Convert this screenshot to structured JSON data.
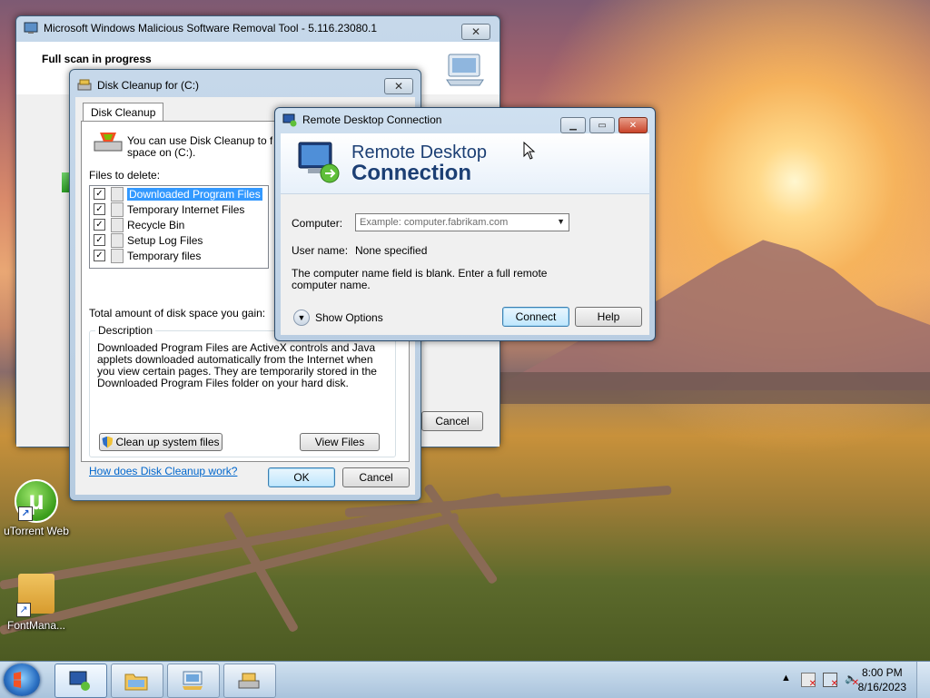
{
  "desktop": {
    "icons": [
      {
        "label": "uTorrent Web"
      },
      {
        "label": "FontMana..."
      }
    ]
  },
  "msrt": {
    "title": "Microsoft Windows Malicious Software Removal Tool - 5.116.23080.1",
    "heading": "Full scan in progress",
    "cancel_label": "Cancel"
  },
  "disk_cleanup": {
    "title": "Disk Cleanup for  (C:)",
    "tab_label": "Disk Cleanup",
    "intro": "You can use Disk Cleanup to free",
    "intro2": "space on  (C:).",
    "files_to_delete_label": "Files to delete:",
    "files": [
      {
        "name": "Downloaded Program Files",
        "checked": true,
        "selected": true
      },
      {
        "name": "Temporary Internet Files",
        "checked": true
      },
      {
        "name": "Recycle Bin",
        "checked": true
      },
      {
        "name": "Setup Log Files",
        "checked": true
      },
      {
        "name": "Temporary files",
        "checked": true
      }
    ],
    "total_label": "Total amount of disk space you gain:",
    "description_legend": "Description",
    "description_text": "Downloaded Program Files are ActiveX controls and Java applets downloaded automatically from the Internet when you view certain pages. They are temporarily stored in the Downloaded Program Files folder on your hard disk.",
    "cleanup_system_label": "Clean up system files",
    "view_files_label": "View Files",
    "help_link": "How does Disk Cleanup work?",
    "ok_label": "OK",
    "cancel_label": "Cancel"
  },
  "rdc": {
    "title": "Remote Desktop Connection",
    "banner_line1": "Remote Desktop",
    "banner_line2": "Connection",
    "computer_label": "Computer:",
    "computer_placeholder": "Example: computer.fabrikam.com",
    "username_label": "User name:",
    "username_value": "None specified",
    "message": "The computer name field is blank. Enter a full remote computer name.",
    "show_options_label": "Show Options",
    "connect_label": "Connect",
    "help_label": "Help"
  },
  "taskbar": {
    "time": "8:00 PM",
    "date": "8/16/2023"
  }
}
